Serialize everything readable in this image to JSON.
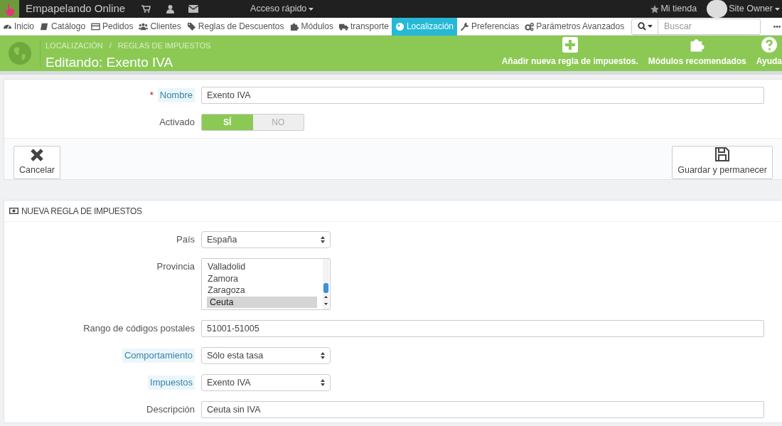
{
  "top_bar": {
    "shop_name": "Empapelando Online",
    "quick_access": "Acceso rápido",
    "my_shop": "Mi tienda",
    "user": "Site Owner"
  },
  "nav": {
    "items": [
      {
        "label": "Inicio",
        "selected": false
      },
      {
        "label": "Catálogo",
        "selected": false
      },
      {
        "label": "Pedidos",
        "selected": false
      },
      {
        "label": "Clientes",
        "selected": false
      },
      {
        "label": "Reglas de Descuentos",
        "selected": false
      },
      {
        "label": "Módulos",
        "selected": false
      },
      {
        "label": "transporte",
        "selected": false
      },
      {
        "label": "Localización",
        "selected": true
      },
      {
        "label": "Preferencias",
        "selected": false
      },
      {
        "label": "Parámetros Avanzados",
        "selected": false
      }
    ],
    "search": {
      "placeholder": "Buscar"
    }
  },
  "header": {
    "breadcrumb": [
      "LOCALIZACIÓN",
      "REGLAS DE IMPUESTOS"
    ],
    "separator": "/",
    "title": "Editando: Exento IVA",
    "actions": [
      "Añadir nueva regla de impuestos.",
      "Módulos recomendados",
      "Ayuda"
    ]
  },
  "tax_rule_form": {
    "fields": [
      {
        "kind": "text",
        "label": "Nombre",
        "required_mark": "*",
        "hint": true,
        "value": "Exento IVA"
      },
      {
        "kind": "switch",
        "label": "Activado",
        "hint": false,
        "options": [
          {
            "label": "SÍ",
            "selected": true
          },
          {
            "label": "NO",
            "selected": false
          }
        ]
      }
    ],
    "buttons": [
      "Cancelar",
      "Guardar y permanecer"
    ]
  },
  "new_rule_form": {
    "title": "NUEVA REGLA DE IMPUESTOS",
    "fields": [
      {
        "kind": "select",
        "label": "País",
        "hint": false,
        "value": "España"
      },
      {
        "kind": "listbox",
        "label": "Provincia",
        "hint": false,
        "options": [
          {
            "label": "Valladolid",
            "selected": false
          },
          {
            "label": "Zamora",
            "selected": false
          },
          {
            "label": "Zaragoza",
            "selected": false
          },
          {
            "label": "Ceuta",
            "selected": true
          }
        ]
      },
      {
        "kind": "text",
        "label": "Rango de códigos postales",
        "hint": false,
        "value": "51001-51005"
      },
      {
        "kind": "select",
        "label": "Comportamiento",
        "hint": true,
        "value": "Sólo esta tasa"
      },
      {
        "kind": "select",
        "label": "Impuestos",
        "hint": true,
        "value": "Exento IVA"
      },
      {
        "kind": "text",
        "label": "Descripción",
        "hint": false,
        "value": "Ceuta sin IVA"
      }
    ]
  }
}
